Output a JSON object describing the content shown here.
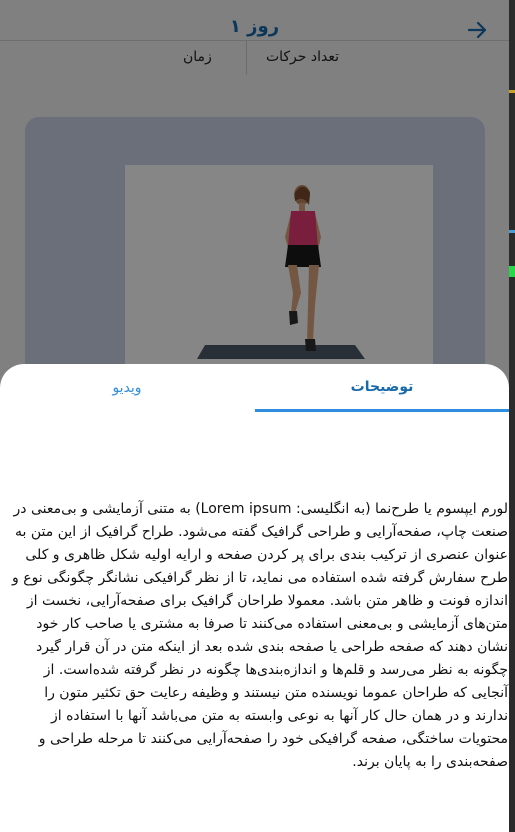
{
  "header": {
    "title": "روز ۱",
    "back_icon": "arrow-right-icon"
  },
  "stats": {
    "moves_label": "تعداد حرکات",
    "time_label": "زمان"
  },
  "sheet": {
    "tab_description": "توضیحات",
    "tab_video": "ویدیو",
    "description": "لورم ایپسوم یا طرح‌نما (به انگلیسی: Lorem ipsum) به متنی آزمایشی و بی‌معنی در صنعت چاپ، صفحه‌آرایی و طراحی گرافیک گفته می‌شود. طراح گرافیک از این متن به عنوان عنصری از ترکیب بندی برای پر کردن صفحه و ارایه اولیه شکل ظاهری و کلی طرح سفارش گرفته شده استفاده می نماید، تا از نظر گرافیکی نشانگر چگونگی نوع و اندازه فونت و ظاهر متن باشد. معمولا طراحان گرافیک برای صفحه‌آرایی، نخست از متن‌های آزمایشی و بی‌معنی استفاده می‌کنند تا صرفا به مشتری یا صاحب کار خود نشان دهند که صفحه طراحی یا صفحه بندی شده بعد از اینکه متن در آن قرار گیرد چگونه به نظر می‌رسد و قلم‌ها و اندازه‌بندی‌ها چگونه در نظر گرفته شده‌است. از آنجایی که طراحان عموما نویسنده متن نیستند و وظیفه رعایت حق تکثیر متون را ندارند و در همان حال کار آنها به نوعی وابسته به متن می‌باشد آنها با استفاده از محتویات ساختگی، صفحه گرافیکی خود را صفحه‌آرایی می‌کنند تا مرحله طراحی و صفحه‌بندی را به پایان برند."
  },
  "colors": {
    "accent": "#1769aa",
    "tab_underline": "#2f8ee0",
    "card_bg": "#c8d2e4"
  }
}
